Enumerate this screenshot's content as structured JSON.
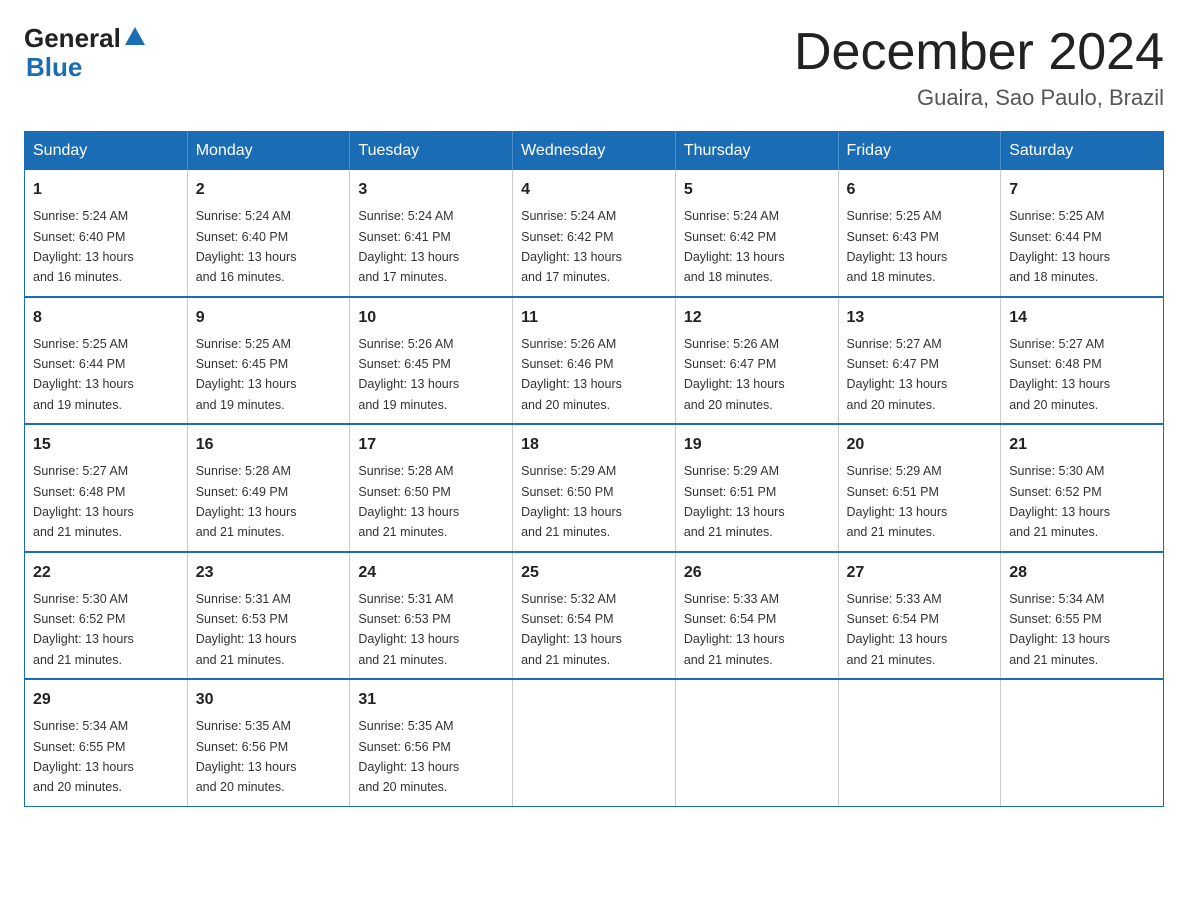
{
  "header": {
    "logo_general": "General",
    "logo_blue": "Blue",
    "month_title": "December 2024",
    "subtitle": "Guaira, Sao Paulo, Brazil"
  },
  "days_of_week": [
    "Sunday",
    "Monday",
    "Tuesday",
    "Wednesday",
    "Thursday",
    "Friday",
    "Saturday"
  ],
  "weeks": [
    [
      {
        "day": "1",
        "sunrise": "5:24 AM",
        "sunset": "6:40 PM",
        "daylight": "13 hours and 16 minutes."
      },
      {
        "day": "2",
        "sunrise": "5:24 AM",
        "sunset": "6:40 PM",
        "daylight": "13 hours and 16 minutes."
      },
      {
        "day": "3",
        "sunrise": "5:24 AM",
        "sunset": "6:41 PM",
        "daylight": "13 hours and 17 minutes."
      },
      {
        "day": "4",
        "sunrise": "5:24 AM",
        "sunset": "6:42 PM",
        "daylight": "13 hours and 17 minutes."
      },
      {
        "day": "5",
        "sunrise": "5:24 AM",
        "sunset": "6:42 PM",
        "daylight": "13 hours and 18 minutes."
      },
      {
        "day": "6",
        "sunrise": "5:25 AM",
        "sunset": "6:43 PM",
        "daylight": "13 hours and 18 minutes."
      },
      {
        "day": "7",
        "sunrise": "5:25 AM",
        "sunset": "6:44 PM",
        "daylight": "13 hours and 18 minutes."
      }
    ],
    [
      {
        "day": "8",
        "sunrise": "5:25 AM",
        "sunset": "6:44 PM",
        "daylight": "13 hours and 19 minutes."
      },
      {
        "day": "9",
        "sunrise": "5:25 AM",
        "sunset": "6:45 PM",
        "daylight": "13 hours and 19 minutes."
      },
      {
        "day": "10",
        "sunrise": "5:26 AM",
        "sunset": "6:45 PM",
        "daylight": "13 hours and 19 minutes."
      },
      {
        "day": "11",
        "sunrise": "5:26 AM",
        "sunset": "6:46 PM",
        "daylight": "13 hours and 20 minutes."
      },
      {
        "day": "12",
        "sunrise": "5:26 AM",
        "sunset": "6:47 PM",
        "daylight": "13 hours and 20 minutes."
      },
      {
        "day": "13",
        "sunrise": "5:27 AM",
        "sunset": "6:47 PM",
        "daylight": "13 hours and 20 minutes."
      },
      {
        "day": "14",
        "sunrise": "5:27 AM",
        "sunset": "6:48 PM",
        "daylight": "13 hours and 20 minutes."
      }
    ],
    [
      {
        "day": "15",
        "sunrise": "5:27 AM",
        "sunset": "6:48 PM",
        "daylight": "13 hours and 21 minutes."
      },
      {
        "day": "16",
        "sunrise": "5:28 AM",
        "sunset": "6:49 PM",
        "daylight": "13 hours and 21 minutes."
      },
      {
        "day": "17",
        "sunrise": "5:28 AM",
        "sunset": "6:50 PM",
        "daylight": "13 hours and 21 minutes."
      },
      {
        "day": "18",
        "sunrise": "5:29 AM",
        "sunset": "6:50 PM",
        "daylight": "13 hours and 21 minutes."
      },
      {
        "day": "19",
        "sunrise": "5:29 AM",
        "sunset": "6:51 PM",
        "daylight": "13 hours and 21 minutes."
      },
      {
        "day": "20",
        "sunrise": "5:29 AM",
        "sunset": "6:51 PM",
        "daylight": "13 hours and 21 minutes."
      },
      {
        "day": "21",
        "sunrise": "5:30 AM",
        "sunset": "6:52 PM",
        "daylight": "13 hours and 21 minutes."
      }
    ],
    [
      {
        "day": "22",
        "sunrise": "5:30 AM",
        "sunset": "6:52 PM",
        "daylight": "13 hours and 21 minutes."
      },
      {
        "day": "23",
        "sunrise": "5:31 AM",
        "sunset": "6:53 PM",
        "daylight": "13 hours and 21 minutes."
      },
      {
        "day": "24",
        "sunrise": "5:31 AM",
        "sunset": "6:53 PM",
        "daylight": "13 hours and 21 minutes."
      },
      {
        "day": "25",
        "sunrise": "5:32 AM",
        "sunset": "6:54 PM",
        "daylight": "13 hours and 21 minutes."
      },
      {
        "day": "26",
        "sunrise": "5:33 AM",
        "sunset": "6:54 PM",
        "daylight": "13 hours and 21 minutes."
      },
      {
        "day": "27",
        "sunrise": "5:33 AM",
        "sunset": "6:54 PM",
        "daylight": "13 hours and 21 minutes."
      },
      {
        "day": "28",
        "sunrise": "5:34 AM",
        "sunset": "6:55 PM",
        "daylight": "13 hours and 21 minutes."
      }
    ],
    [
      {
        "day": "29",
        "sunrise": "5:34 AM",
        "sunset": "6:55 PM",
        "daylight": "13 hours and 20 minutes."
      },
      {
        "day": "30",
        "sunrise": "5:35 AM",
        "sunset": "6:56 PM",
        "daylight": "13 hours and 20 minutes."
      },
      {
        "day": "31",
        "sunrise": "5:35 AM",
        "sunset": "6:56 PM",
        "daylight": "13 hours and 20 minutes."
      },
      null,
      null,
      null,
      null
    ]
  ],
  "labels": {
    "sunrise": "Sunrise:",
    "sunset": "Sunset:",
    "daylight": "Daylight:"
  }
}
